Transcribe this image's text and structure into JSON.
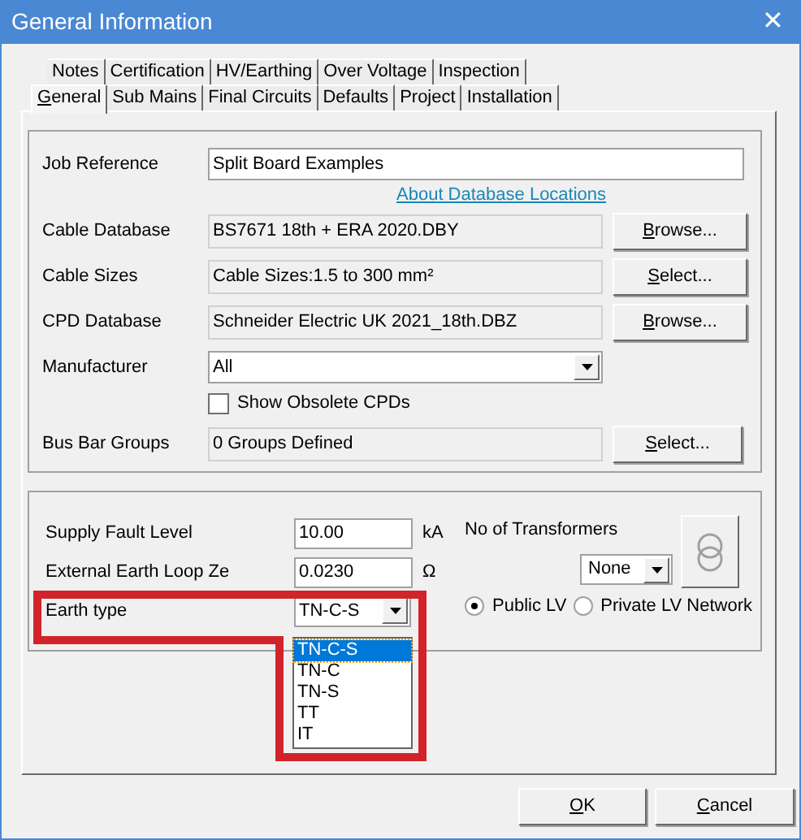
{
  "window": {
    "title": "General Information",
    "close": "✕"
  },
  "tab_rows": [
    [
      {
        "label": "Notes",
        "selected": false
      },
      {
        "label": "Certification",
        "selected": false
      },
      {
        "label": "HV/Earthing",
        "selected": false
      },
      {
        "label": "Over Voltage",
        "selected": false
      },
      {
        "label": "Inspection",
        "selected": false
      }
    ],
    [
      {
        "label": "General",
        "selected": true
      },
      {
        "label": "Sub Mains",
        "selected": false
      },
      {
        "label": "Final Circuits",
        "selected": false
      },
      {
        "label": "Defaults",
        "selected": false
      },
      {
        "label": "Project",
        "selected": false
      },
      {
        "label": "Installation",
        "selected": false
      }
    ]
  ],
  "job_reference": {
    "label": "Job Reference",
    "value": "Split Board Examples"
  },
  "link": "About Database Locations",
  "database_rows": [
    {
      "kind": "readonly",
      "label": "Cable Database",
      "value": "BS7671 18th + ERA 2020.DBY",
      "button": "Browse..."
    },
    {
      "kind": "readonly",
      "label": "Cable Sizes",
      "value": "Cable Sizes:1.5 to 300 mm²",
      "button": "Select..."
    },
    {
      "kind": "readonly",
      "label": "CPD Database",
      "value": "Schneider Electric UK 2021_18th.DBZ",
      "button": "Browse..."
    },
    {
      "kind": "dropdown",
      "label": "Manufacturer",
      "value": "All"
    }
  ],
  "show_obsolete": {
    "label": "Show Obsolete CPDs",
    "checked": false
  },
  "bus_bar": {
    "label": "Bus Bar Groups",
    "value": "0 Groups Defined",
    "button": "Select..."
  },
  "supply_fault": {
    "label": "Supply Fault Level",
    "value": "10.00",
    "unit": "kA"
  },
  "external_ze": {
    "label": "External Earth Loop Ze",
    "value": "0.0230",
    "unit": "Ω"
  },
  "transformers": {
    "label": "No of Transformers",
    "value": "None"
  },
  "earth_type": {
    "label": "Earth type",
    "value": "TN-C-S",
    "expanded": true,
    "options": [
      {
        "label": "TN-C-S",
        "selected": true
      },
      {
        "label": "TN-C",
        "selected": false
      },
      {
        "label": "TN-S",
        "selected": false
      },
      {
        "label": "TT",
        "selected": false
      },
      {
        "label": "IT",
        "selected": false
      }
    ]
  },
  "network": [
    {
      "label": "Public LV",
      "selected": true
    },
    {
      "label": "Private LV Network",
      "selected": false
    }
  ],
  "buttons": [
    "OK",
    "Cancel"
  ]
}
